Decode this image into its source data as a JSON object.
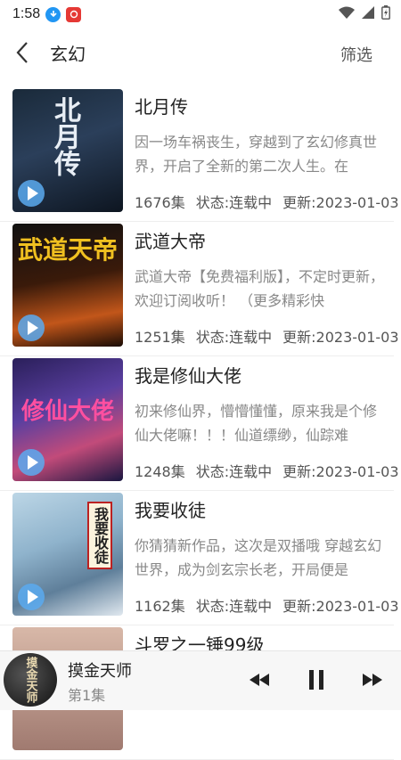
{
  "status_bar": {
    "time": "1:58",
    "icons": [
      "download-icon",
      "music-app-icon",
      "wifi-icon",
      "signal-icon",
      "battery-icon"
    ]
  },
  "header": {
    "title": "玄幻",
    "filter_label": "筛选"
  },
  "books": [
    {
      "name": "北月传",
      "desc": "因一场车祸丧生，穿越到了玄幻修真世界，开启了全新的第二次人生。在",
      "episodes": "1676集",
      "status": "状态:连载中",
      "updated": "更新:2023-01-03",
      "cover_text": "北月传"
    },
    {
      "name": "武道大帝",
      "desc": "武道大帝【免费福利版】，不定时更新，欢迎订阅收听！ （更多精彩快",
      "episodes": "1251集",
      "status": "状态:连载中",
      "updated": "更新:2023-01-03",
      "cover_text": "武道天帝"
    },
    {
      "name": "我是修仙大佬",
      "desc": "初来修仙界，懵懵懂懂，原来我是个修仙大佬嘛！！！仙道缥缈，仙踪难",
      "episodes": "1248集",
      "status": "状态:连载中",
      "updated": "更新:2023-01-03",
      "cover_text": "修仙大佬"
    },
    {
      "name": "我要收徒",
      "desc": "你猜猜新作品，这次是双播哦 穿越玄幻世界，成为剑玄宗长老，开局便是",
      "episodes": "1162集",
      "status": "状态:连载中",
      "updated": "更新:2023-01-03",
      "cover_text": "我要收徒"
    },
    {
      "name": "斗罗之一锤99级",
      "desc": "",
      "episodes": "",
      "status": "",
      "updated": "",
      "cover_text": ""
    }
  ],
  "player": {
    "title": "摸金天师",
    "episode": "第1集",
    "cover_text": "摸金天师"
  },
  "colors": {
    "accent": "#5aaaf0",
    "text": "#222222",
    "muted": "#888888"
  }
}
